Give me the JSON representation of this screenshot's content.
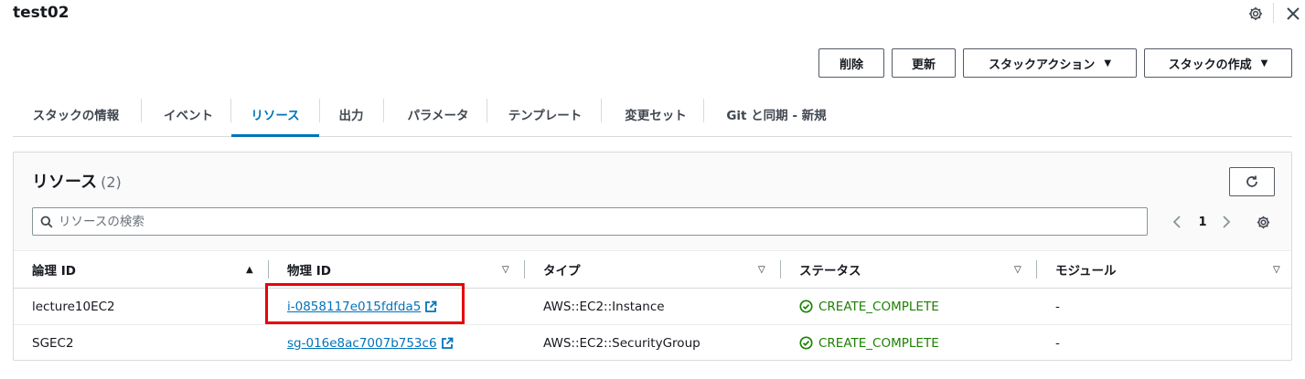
{
  "header": {
    "title": "test02",
    "gear_icon": "gear-icon",
    "close_icon": "close-icon"
  },
  "actions": {
    "delete": "削除",
    "update": "更新",
    "stack_action": "スタックアクション",
    "create_stack": "スタックの作成"
  },
  "tabs": [
    {
      "label": "スタックの情報",
      "active": false
    },
    {
      "label": "イベント",
      "active": false
    },
    {
      "label": "リソース",
      "active": true
    },
    {
      "label": "出力",
      "active": false
    },
    {
      "label": "パラメータ",
      "active": false
    },
    {
      "label": "テンプレート",
      "active": false
    },
    {
      "label": "変更セット",
      "active": false
    },
    {
      "label": "Git と同期 - 新規",
      "active": false
    }
  ],
  "resources": {
    "title": "リソース",
    "count": "(2)",
    "search_placeholder": "リソースの検索",
    "page": "1",
    "columns": [
      "論理 ID",
      "物理 ID",
      "タイプ",
      "ステータス",
      "モジュール"
    ],
    "rows": [
      {
        "logical_id": "lecture10EC2",
        "physical_id": "i-0858117e015fdfda5",
        "type": "AWS::EC2::Instance",
        "status": "CREATE_COMPLETE",
        "module": "-"
      },
      {
        "logical_id": "SGEC2",
        "physical_id": "sg-016e8ac7007b753c6",
        "type": "AWS::EC2::SecurityGroup",
        "status": "CREATE_COMPLETE",
        "module": "-"
      }
    ]
  },
  "colors": {
    "accent": "#0073bb",
    "success": "#1d8102",
    "highlight": "#e8000b"
  }
}
